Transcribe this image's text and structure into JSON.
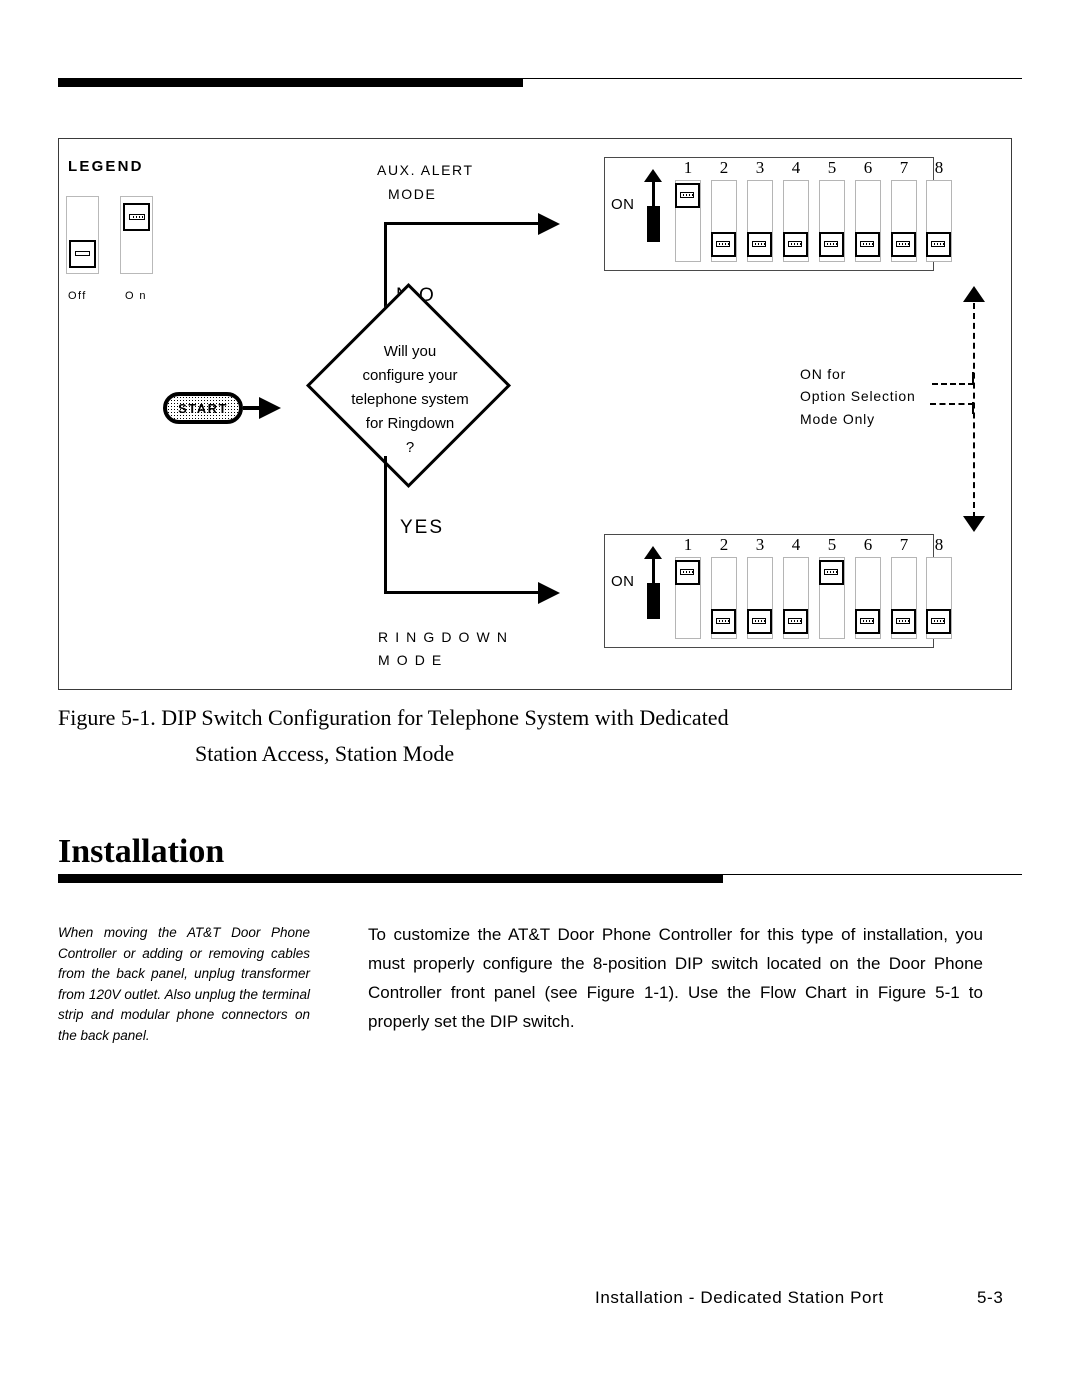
{
  "header_rule": {
    "accent_color": "#000000"
  },
  "figure": {
    "legend": {
      "title": "LEGEND",
      "off_label": "Off",
      "on_label": "O n"
    },
    "flow": {
      "start_label": "START",
      "decision_lines": [
        "Will you",
        "configure your",
        "telephone system",
        "for Ringdown",
        "?"
      ],
      "branch_no": "N O",
      "branch_yes": "YES",
      "aux_alert_mode_line1": "AUX.  ALERT",
      "aux_alert_mode_line2": "MODE",
      "ringdown_mode_line1": "R I N G D O W N",
      "ringdown_mode_line2": "M O D E",
      "note_lines": [
        "ON  for",
        "Option   Selection",
        "Mode  Only"
      ]
    },
    "dip_switches": {
      "on_label": "ON",
      "numbers": [
        "1",
        "2",
        "3",
        "4",
        "5",
        "6",
        "7",
        "8"
      ],
      "panel_aux_alert": {
        "states": [
          "on",
          "off",
          "off",
          "off",
          "off",
          "off",
          "off",
          "off"
        ]
      },
      "panel_ringdown": {
        "states": [
          "on",
          "off",
          "off",
          "off",
          "on",
          "off",
          "off",
          "off"
        ]
      }
    }
  },
  "caption": {
    "line1": "Figure 5-1. DIP Switch Configuration for Telephone System with Dedicated",
    "line2": "Station Access, Station Mode"
  },
  "section": {
    "heading": "Installation"
  },
  "margin_note": {
    "text": "When moving the AT&T Door Phone Controller or adding or removing cables from the back panel, unplug transformer from 120V outlet. Also unplug the terminal strip and modular phone connectors on the back panel."
  },
  "body": {
    "paragraph": "To customize the AT&T Door Phone Controller for this type of installation, you must properly configure the 8-position DIP switch located on the Door Phone Controller front panel (see Figure 1-1). Use the Flow Chart in Figure 5-1 to properly set the DIP switch."
  },
  "footer": {
    "title": "Installation  -  Dedicated  Station  Port",
    "page_number": "5-3"
  }
}
